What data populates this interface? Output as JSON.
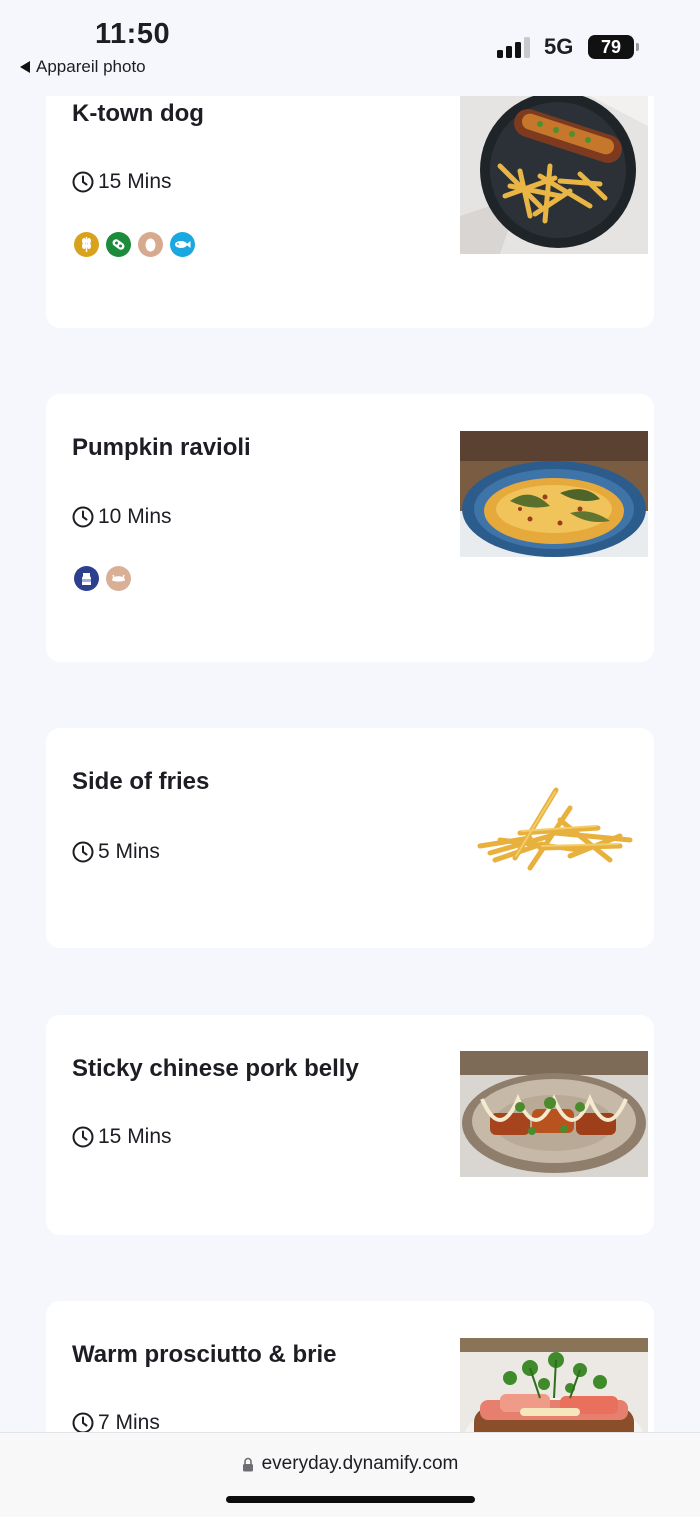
{
  "status_bar": {
    "time": "11:50",
    "back_label": "Appareil photo",
    "network": "5G",
    "battery": "79"
  },
  "menu": {
    "items": [
      {
        "name": "K-town dog",
        "time": "15 Mins",
        "allergens": [
          "gluten-icon",
          "soy-icon",
          "egg-icon",
          "fish-icon"
        ]
      },
      {
        "name": "Pumpkin ravioli",
        "time": "10 Mins",
        "allergens": [
          "milk-icon",
          "crustacean-icon"
        ]
      },
      {
        "name": "Side of fries",
        "time": "5 Mins",
        "allergens": []
      },
      {
        "name": "Sticky chinese pork belly",
        "time": "15 Mins",
        "allergens": []
      },
      {
        "name": "Warm prosciutto & brie",
        "time": "7 Mins",
        "allergens": []
      }
    ]
  },
  "browser": {
    "url": "everyday.dynamify.com"
  },
  "colors": {
    "gluten": "#d9a21c",
    "soy": "#1c8b3c",
    "egg": "#d7aa8f",
    "fish": "#1aa8e0",
    "milk": "#2d3f8f",
    "crustacean": "#d9b096"
  }
}
